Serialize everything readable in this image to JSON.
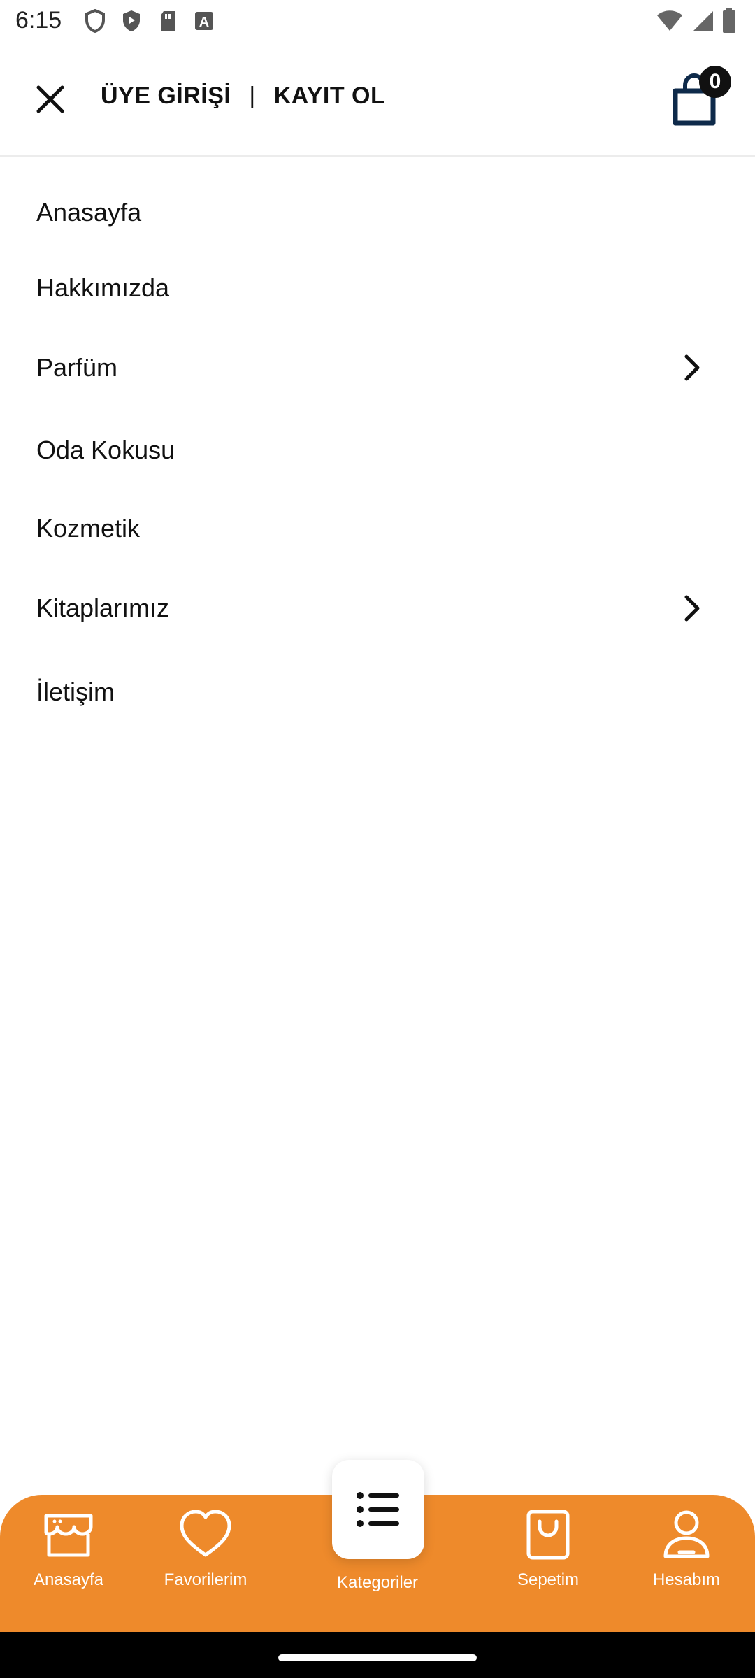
{
  "status_bar": {
    "time": "6:15"
  },
  "header": {
    "login_label": "ÜYE GİRİŞİ",
    "separator": "|",
    "register_label": "KAYIT OL",
    "cart_count": "0"
  },
  "menu": {
    "items": [
      {
        "label": "Anasayfa"
      },
      {
        "label": "Hakkımızda"
      },
      {
        "label": "Parfüm"
      },
      {
        "label": "Oda Kokusu"
      },
      {
        "label": "Kozmetik"
      },
      {
        "label": "Kitaplarımız"
      },
      {
        "label": "İletişim"
      }
    ]
  },
  "bottom_nav": {
    "items": [
      {
        "label": "Anasayfa",
        "icon": "store-icon"
      },
      {
        "label": "Favorilerim",
        "icon": "heart-icon"
      },
      {
        "label": "Kategoriler",
        "icon": "list-icon"
      },
      {
        "label": "Sepetim",
        "icon": "bag-icon"
      },
      {
        "label": "Hesabım",
        "icon": "user-icon"
      }
    ]
  },
  "colors": {
    "accent": "#EE8A2B",
    "text": "#111111",
    "background": "#FFFFFF"
  }
}
